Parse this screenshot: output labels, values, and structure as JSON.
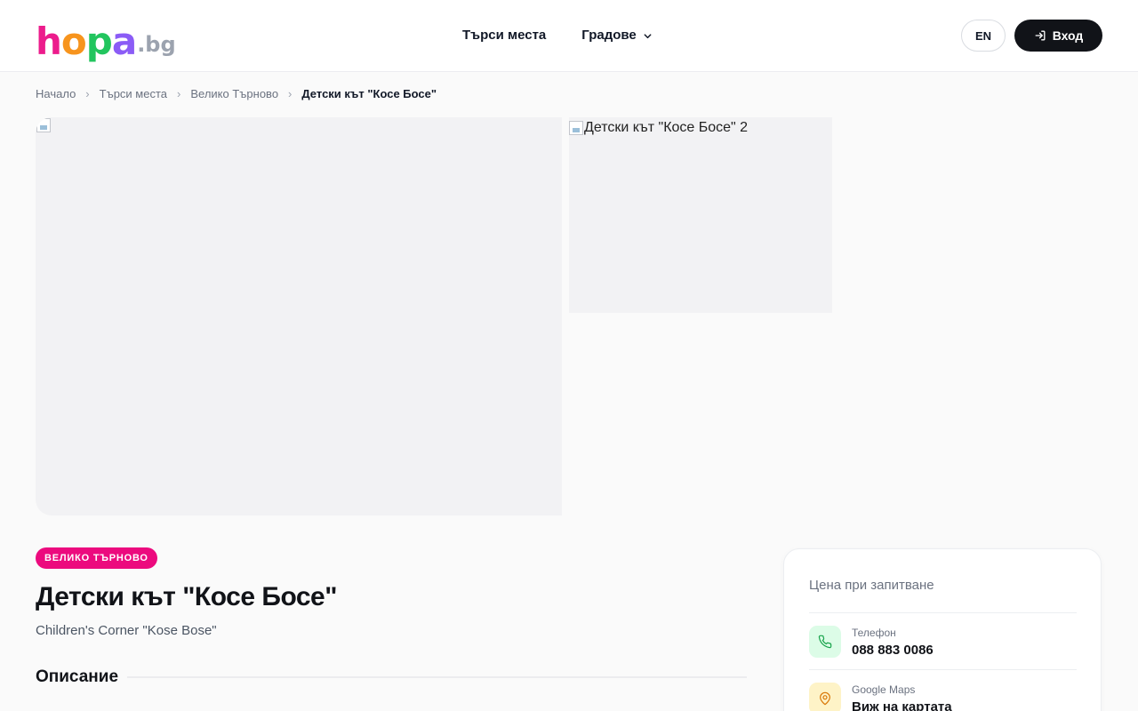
{
  "logo": {
    "letters": [
      "h",
      "o",
      "p",
      "a"
    ],
    "letter_colors": [
      "#ec1c8c",
      "#f7941d",
      "#22c55e",
      "#8b5cf6"
    ],
    "suffix": ".bg"
  },
  "nav": {
    "search_places": "Търси места",
    "cities": "Градове"
  },
  "header": {
    "lang": "EN",
    "login": "Вход"
  },
  "breadcrumb": {
    "home": "Начало",
    "search": "Търси места",
    "city": "Велико Търново",
    "current": "Детски кът \"Косе Босе\""
  },
  "gallery": {
    "image_2_alt": "Детски кът \"Косе Босе\" 2"
  },
  "place": {
    "city_badge": "ВЕЛИКО ТЪРНОВО",
    "title": "Детски кът \"Косе Босе\"",
    "subtitle": "Children's Corner \"Kose Bose\"",
    "description_heading": "Описание"
  },
  "sidebar": {
    "price": "Цена при запитване",
    "phone_label": "Телефон",
    "phone_value": "088 883 0086",
    "maps_label": "Google Maps",
    "maps_value": "Виж на картата"
  },
  "colors": {
    "badge": "#ec0a7e",
    "login_bg": "#111318",
    "phone_icon_bg": "#dcfce7",
    "phone_icon": "#16a34a",
    "maps_icon_bg": "#fef3c7",
    "maps_icon": "#d97706"
  }
}
